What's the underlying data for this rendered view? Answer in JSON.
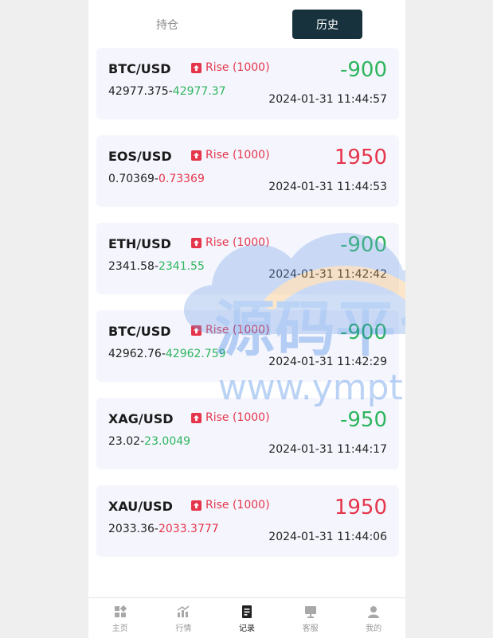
{
  "tabs": {
    "holdings": "持仓",
    "history": "历史"
  },
  "records": [
    {
      "symbol": "BTC/USD",
      "direction": "Rise (1000)",
      "open": "42977.375",
      "close": "42977.37",
      "close_color": "green",
      "profit": "-900",
      "profit_color": "green",
      "time": "2024-01-31 11:44:57"
    },
    {
      "symbol": "EOS/USD",
      "direction": "Rise (1000)",
      "open": "0.70369",
      "close": "0.73369",
      "close_color": "red",
      "profit": "1950",
      "profit_color": "red",
      "time": "2024-01-31 11:44:53"
    },
    {
      "symbol": "ETH/USD",
      "direction": "Rise (1000)",
      "open": "2341.58",
      "close": "2341.55",
      "close_color": "green",
      "profit": "-900",
      "profit_color": "green",
      "time": "2024-01-31 11:42:42"
    },
    {
      "symbol": "BTC/USD",
      "direction": "Rise (1000)",
      "open": "42962.76",
      "close": "42962.759",
      "close_color": "green",
      "profit": "-900",
      "profit_color": "green",
      "time": "2024-01-31 11:42:29"
    },
    {
      "symbol": "XAG/USD",
      "direction": "Rise (1000)",
      "open": "23.02",
      "close": "23.0049",
      "close_color": "green",
      "profit": "-950",
      "profit_color": "green",
      "time": "2024-01-31 11:44:17"
    },
    {
      "symbol": "XAU/USD",
      "direction": "Rise (1000)",
      "open": "2033.36",
      "close": "2033.3777",
      "close_color": "red",
      "profit": "1950",
      "profit_color": "red",
      "time": "2024-01-31 11:44:06"
    }
  ],
  "watermark": {
    "title": "源码平台",
    "url": "www.ympt.cc"
  },
  "nav": [
    {
      "label": "主页",
      "icon": "home-icon"
    },
    {
      "label": "行情",
      "icon": "market-chart-icon"
    },
    {
      "label": "记录",
      "icon": "record-icon"
    },
    {
      "label": "客服",
      "icon": "support-icon"
    },
    {
      "label": "我的",
      "icon": "profile-icon"
    }
  ],
  "colors": {
    "rise": "#e5354b",
    "fall": "#2db55d",
    "active_tab": "#17313d"
  }
}
